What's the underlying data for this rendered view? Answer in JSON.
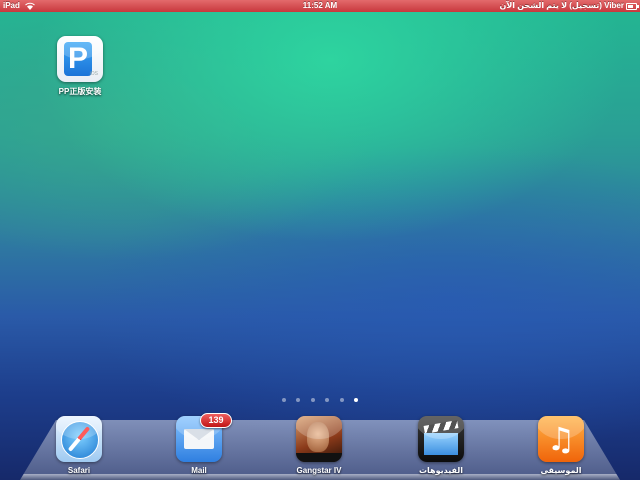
{
  "status_bar": {
    "device": "iPad",
    "time": "11:52 AM",
    "right_text": "Viber (تسجيل) لا يتم الشحن الآن",
    "wifi_icon": "wifi-icon",
    "battery_icon": "battery-icon"
  },
  "home_apps": [
    {
      "label": "PP正版安装",
      "icon": "pp-assistant-icon",
      "icon_text": "P",
      "icon_subtext": "iOS"
    }
  ],
  "page_indicator": {
    "pages": 6,
    "current": 6
  },
  "dock": [
    {
      "label": "Safari",
      "icon": "safari-icon"
    },
    {
      "label": "Mail",
      "icon": "mail-icon",
      "badge": "139"
    },
    {
      "label": "Gangstar IV",
      "icon": "gangstar-icon"
    },
    {
      "label": "الفيديوهات",
      "icon": "videos-icon"
    },
    {
      "label": "الموسيقى",
      "icon": "music-icon",
      "icon_glyph": "♫"
    }
  ],
  "colors": {
    "status_bar": "#d0454a",
    "badge": "#d42020"
  }
}
